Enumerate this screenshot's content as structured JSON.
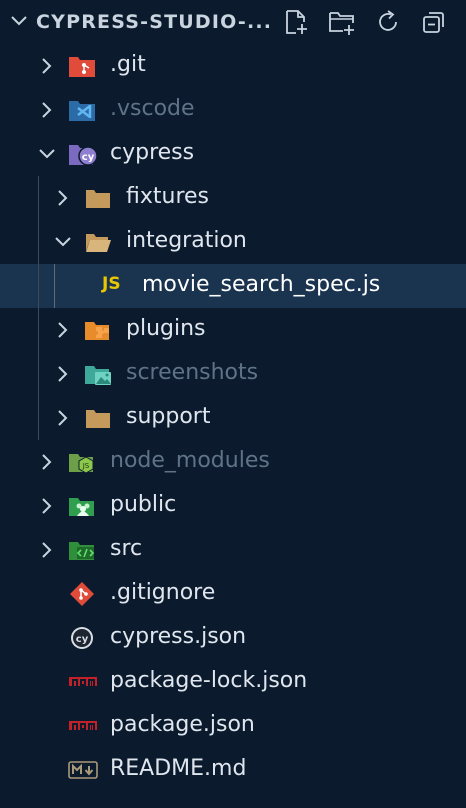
{
  "header": {
    "title": "CYPRESS-STUDIO-...",
    "actions": [
      {
        "name": "new-file-icon"
      },
      {
        "name": "new-folder-icon"
      },
      {
        "name": "refresh-icon"
      },
      {
        "name": "collapse-all-icon"
      }
    ]
  },
  "tree": {
    "items": [
      {
        "label": ".git",
        "type": "folder",
        "icon": "git-folder-icon",
        "depth": 0,
        "state": "collapsed",
        "dimmed": false
      },
      {
        "label": ".vscode",
        "type": "folder",
        "icon": "vscode-folder-icon",
        "depth": 0,
        "state": "collapsed",
        "dimmed": true
      },
      {
        "label": "cypress",
        "type": "folder",
        "icon": "cypress-folder-icon",
        "depth": 0,
        "state": "expanded",
        "dimmed": false
      },
      {
        "label": "fixtures",
        "type": "folder",
        "icon": "folder-icon",
        "depth": 1,
        "state": "collapsed",
        "dimmed": false
      },
      {
        "label": "integration",
        "type": "folder",
        "icon": "folder-open-icon",
        "depth": 1,
        "state": "expanded",
        "dimmed": false
      },
      {
        "label": "movie_search_spec.js",
        "type": "file",
        "icon": "js-file-icon",
        "icon_text": "JS",
        "depth": 2,
        "selected": true,
        "dimmed": false
      },
      {
        "label": "plugins",
        "type": "folder",
        "icon": "plugin-folder-icon",
        "depth": 1,
        "state": "collapsed",
        "dimmed": false
      },
      {
        "label": "screenshots",
        "type": "folder",
        "icon": "images-folder-icon",
        "depth": 1,
        "state": "collapsed",
        "dimmed": true
      },
      {
        "label": "support",
        "type": "folder",
        "icon": "folder-icon",
        "depth": 1,
        "state": "collapsed",
        "dimmed": false
      },
      {
        "label": "node_modules",
        "type": "folder",
        "icon": "node-folder-icon",
        "depth": 0,
        "state": "collapsed",
        "dimmed": true
      },
      {
        "label": "public",
        "type": "folder",
        "icon": "public-folder-icon",
        "depth": 0,
        "state": "collapsed",
        "dimmed": false
      },
      {
        "label": "src",
        "type": "folder",
        "icon": "src-folder-icon",
        "depth": 0,
        "state": "collapsed",
        "dimmed": false
      },
      {
        "label": ".gitignore",
        "type": "file",
        "icon": "git-icon",
        "depth": 0,
        "dimmed": false
      },
      {
        "label": "cypress.json",
        "type": "file",
        "icon": "cypress-icon",
        "icon_text": "cy",
        "depth": 0,
        "dimmed": false
      },
      {
        "label": "package-lock.json",
        "type": "file",
        "icon": "npm-icon",
        "icon_text": "npm",
        "depth": 0,
        "dimmed": false
      },
      {
        "label": "package.json",
        "type": "file",
        "icon": "npm-icon",
        "icon_text": "npm",
        "depth": 0,
        "dimmed": false
      },
      {
        "label": "README.md",
        "type": "file",
        "icon": "markdown-icon",
        "icon_text": "M↓",
        "depth": 0,
        "dimmed": false
      }
    ]
  },
  "colors": {
    "background": "#0b1a2d",
    "selected_row": "#1a3450",
    "text": "#dfe6ee",
    "dim_text": "#5f7387",
    "folder": "#c39a5b",
    "js": "#e8c700"
  }
}
